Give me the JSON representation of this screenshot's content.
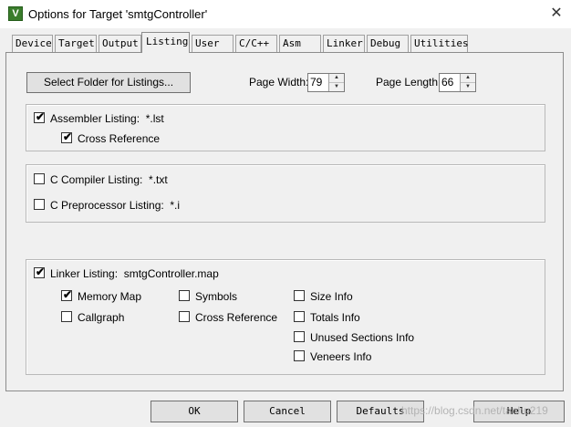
{
  "window": {
    "title": "Options for Target 'smtgController'",
    "app_icon_letter": "V",
    "close_glyph": "✕"
  },
  "tabs": [
    {
      "label": "Device"
    },
    {
      "label": "Target"
    },
    {
      "label": "Output"
    },
    {
      "label": "Listing"
    },
    {
      "label": "User"
    },
    {
      "label": "C/C++"
    },
    {
      "label": "Asm"
    },
    {
      "label": "Linker"
    },
    {
      "label": "Debug"
    },
    {
      "label": "Utilities"
    }
  ],
  "active_tab": "Listing",
  "listing": {
    "select_folder_button": "Select Folder for Listings...",
    "page_width_label": "Page Width:",
    "page_width_value": "79",
    "page_length_label": "Page Length:",
    "page_length_value": "66"
  },
  "assembler": {
    "listing_label": "Assembler Listing:",
    "listing_file": "*.lst",
    "listing_checked": true,
    "cross_reference_label": "Cross Reference",
    "cross_reference_checked": true
  },
  "compiler": {
    "c_compiler_label": "C Compiler Listing:",
    "c_compiler_file": "*.txt",
    "c_compiler_checked": false,
    "c_preprocessor_label": "C Preprocessor Listing:",
    "c_preprocessor_file": "*.i",
    "c_preprocessor_checked": false
  },
  "linker": {
    "listing_label": "Linker Listing:",
    "listing_file": "smtgController.map",
    "listing_checked": true,
    "options": [
      {
        "label": "Memory Map",
        "checked": true
      },
      {
        "label": "Callgraph",
        "checked": false
      },
      {
        "label": "Symbols",
        "checked": false
      },
      {
        "label": "Cross Reference",
        "checked": false
      },
      {
        "label": "Size Info",
        "checked": false
      },
      {
        "label": "Totals Info",
        "checked": false
      },
      {
        "label": "Unused Sections Info",
        "checked": false
      },
      {
        "label": "Veneers Info",
        "checked": false
      }
    ]
  },
  "buttons": {
    "ok": "OK",
    "cancel": "Cancel",
    "defaults": "Defaults",
    "help": "Help"
  },
  "watermark": "https://blog.csdn.net/tanhu219",
  "colors": {
    "window_bg": "#f0f0f0",
    "titlebar_bg": "#ffffff",
    "icon_green": "#3a7d2c"
  }
}
